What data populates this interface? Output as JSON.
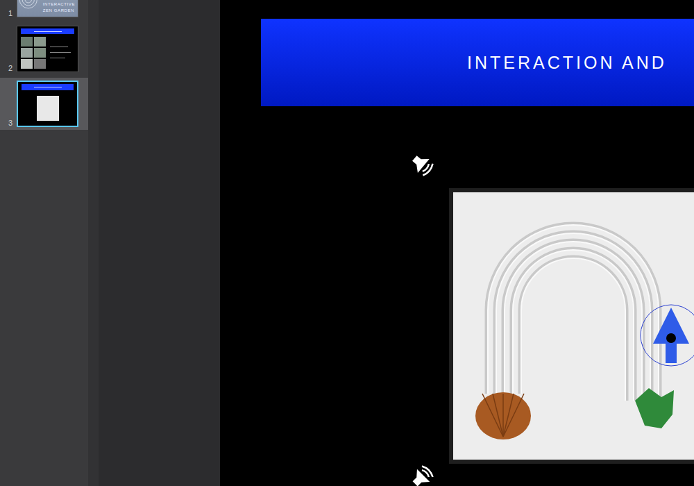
{
  "slide_navigator": {
    "slides": [
      {
        "number": "1",
        "kind": "title",
        "selected": false,
        "title_lines": [
          "INTERACTIVE",
          "ZEN GARDEN"
        ]
      },
      {
        "number": "2",
        "kind": "photo-grid",
        "selected": false,
        "title_lines": []
      },
      {
        "number": "3",
        "kind": "garden",
        "selected": true,
        "title_lines": []
      }
    ]
  },
  "slide": {
    "title": "INTERACTION AND"
  }
}
